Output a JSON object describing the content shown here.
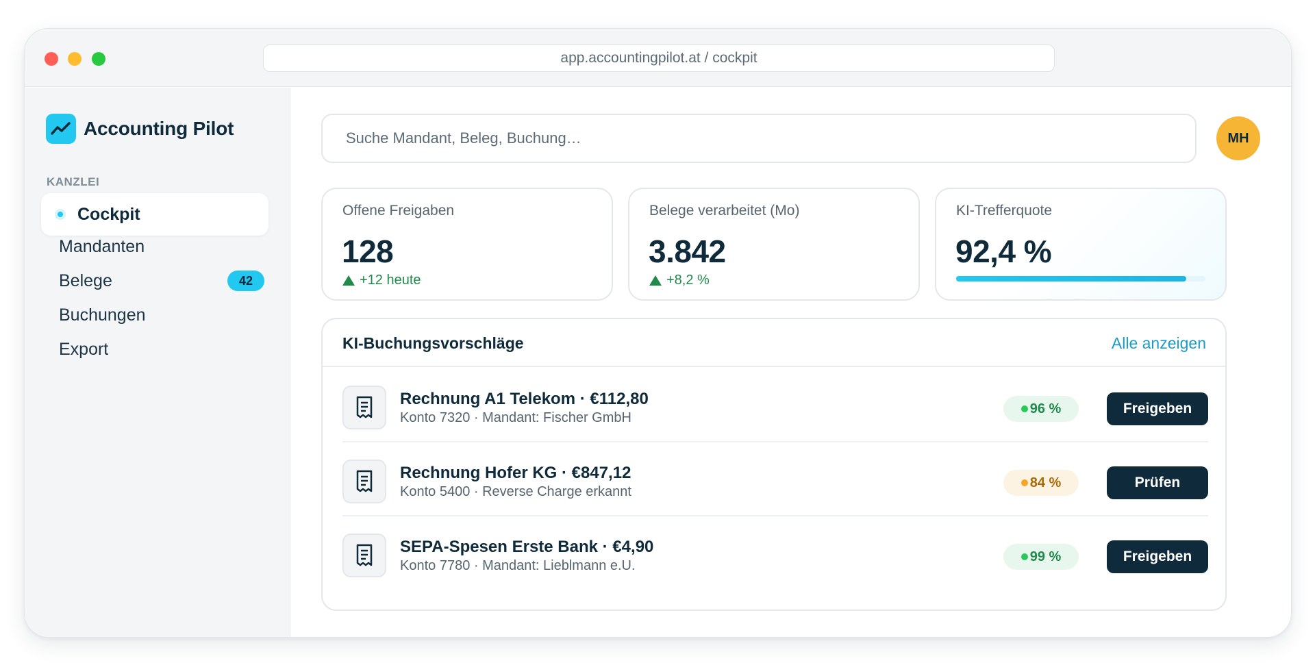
{
  "browser": {
    "url": "app.accountingpilot.at / cockpit"
  },
  "sidebar": {
    "brand": "Accounting Pilot",
    "section_label": "KANZLEI",
    "items": [
      {
        "label": "Cockpit",
        "active": true
      },
      {
        "label": "Mandanten"
      },
      {
        "label": "Belege",
        "badge": "42"
      },
      {
        "label": "Buchungen"
      },
      {
        "label": "Export"
      }
    ]
  },
  "header": {
    "search_placeholder": "Suche Mandant, Beleg, Buchung…",
    "avatar_initials": "MH"
  },
  "stats": [
    {
      "label": "Offene Freigaben",
      "value": "128",
      "delta": "+12 heute"
    },
    {
      "label": "Belege verarbeitet (Mo)",
      "value": "3.842",
      "delta": "+8,2 %"
    },
    {
      "label": "KI-Trefferquote",
      "value": "92,4 %",
      "progress": 0.924
    }
  ],
  "suggestions": {
    "title": "KI-Buchungsvorschläge",
    "link": "Alle anzeigen",
    "rows": [
      {
        "title": "Rechnung A1 Telekom · €112,80",
        "subtitle": "Konto 7320 · Mandant: Fischer GmbH",
        "confidence": "96 %",
        "level": "green",
        "action": "Freigeben"
      },
      {
        "title": "Rechnung Hofer KG · €847,12",
        "subtitle": "Konto 5400 · Reverse Charge erkannt",
        "confidence": "84 %",
        "level": "amber",
        "action": "Prüfen"
      },
      {
        "title": "SEPA-Spesen Erste Bank · €4,90",
        "subtitle": "Konto 7780 · Mandant: Lieblmann e.U.",
        "confidence": "99 %",
        "level": "green",
        "action": "Freigeben"
      }
    ]
  },
  "colors": {
    "accent": "#22c8ef",
    "dark": "#0f2a3a",
    "positive": "#1f8a4c",
    "warning": "#f5a524",
    "avatar": "#f7b536"
  }
}
